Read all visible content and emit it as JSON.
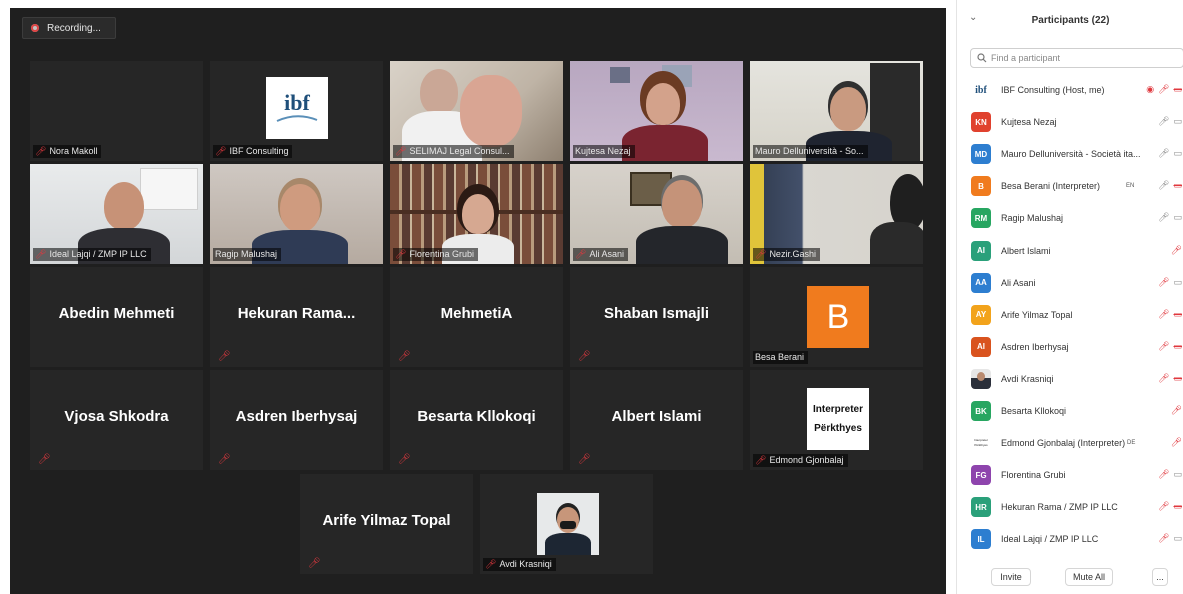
{
  "recording": {
    "label": "Recording..."
  },
  "grid": {
    "row1": [
      {
        "name": "Nora Makoll",
        "muted": true
      },
      {
        "name": "IBF Consulting",
        "muted": true,
        "logo_text": "ibf"
      },
      {
        "name": "SELIMAJ Legal Consul...",
        "muted": true
      },
      {
        "name": "Kujtesa Nezaj",
        "muted": false,
        "active_speaker": true
      },
      {
        "name": "Mauro Delluniversità - So...",
        "muted": false
      }
    ],
    "row2": [
      {
        "name": "Ideal Lajqi / ZMP IP LLC",
        "muted": true
      },
      {
        "name": "Ragip Malushaj",
        "muted": false
      },
      {
        "name": "Florentina Grubi",
        "muted": true
      },
      {
        "name": "Ali Asani",
        "muted": true
      },
      {
        "name": "Nezir.Gashi",
        "muted": true
      }
    ],
    "row3": [
      {
        "name": "Abedin Mehmeti"
      },
      {
        "name": "Hekuran  Rama..."
      },
      {
        "name": "MehmetiA"
      },
      {
        "name": "Shaban Ismajli"
      },
      {
        "name": "Besa Berani",
        "avatar_letter": "B"
      }
    ],
    "row4": [
      {
        "name": "Vjosa Shkodra"
      },
      {
        "name": "Asdren Iberhysaj"
      },
      {
        "name": "Besarta Kllokoqi"
      },
      {
        "name": "Albert Islami"
      },
      {
        "name": "Edmond Gjonbalaj",
        "card_line1": "Interpreter",
        "card_line2": "Përkthyes"
      }
    ],
    "row5": [
      {
        "name": "Arife Yilmaz Topal"
      },
      {
        "name": "Avdi Krasniqi"
      }
    ]
  },
  "panel": {
    "title": "Participants (22)",
    "collapse_icon": "chevron-down-icon",
    "search_placeholder": "Find a participant",
    "participants": [
      {
        "initials": "ibf",
        "name": "IBF Consulting (Host, me)",
        "color": "#ffffff",
        "badge": "",
        "mic": "muted",
        "video": "off",
        "sharing": true
      },
      {
        "initials": "KN",
        "name": "Kujtesa Nezaj",
        "color": "#e0412e",
        "badge": "",
        "mic": "on",
        "video": "on"
      },
      {
        "initials": "MD",
        "name": "Mauro Delluniversità - Società ita...",
        "color": "#2d7ed0",
        "badge": "",
        "mic": "on",
        "video": "on"
      },
      {
        "initials": "B",
        "name": "Besa Berani (Interpreter)",
        "color": "#f07b1e",
        "badge": "EN",
        "mic": "on",
        "video": "off"
      },
      {
        "initials": "RM",
        "name": "Ragip Malushaj",
        "color": "#27a661",
        "badge": "",
        "mic": "on",
        "video": "on"
      },
      {
        "initials": "AI",
        "name": "Albert Islami",
        "color": "#2aa07a",
        "badge": "",
        "mic": "muted",
        "video": "none"
      },
      {
        "initials": "AA",
        "name": "Ali Asani",
        "color": "#2d7ed0",
        "badge": "",
        "mic": "muted",
        "video": "on"
      },
      {
        "initials": "AY",
        "name": "Arife Yilmaz Topal",
        "color": "#f2a31b",
        "badge": "",
        "mic": "muted",
        "video": "off"
      },
      {
        "initials": "AI",
        "name": "Asdren Iberhysaj",
        "color": "#d9531e",
        "badge": "",
        "mic": "muted",
        "video": "off"
      },
      {
        "initials": "",
        "name": "Avdi Krasniqi",
        "color": "#8a8a8a",
        "badge": "",
        "mic": "muted",
        "video": "off",
        "photo": true
      },
      {
        "initials": "BK",
        "name": "Besarta Kllokoqi",
        "color": "#27a661",
        "badge": "",
        "mic": "muted",
        "video": "none"
      },
      {
        "initials": "Interpreter Përkthyes",
        "name": "Edmond Gjonbalaj (Interpreter)",
        "color": "#ffffff",
        "badge": "DE",
        "mic": "muted",
        "video": "none"
      },
      {
        "initials": "FG",
        "name": "Florentina Grubi",
        "color": "#8e44ad",
        "badge": "",
        "mic": "muted",
        "video": "on"
      },
      {
        "initials": "HR",
        "name": "Hekuran Rama / ZMP IP LLC",
        "color": "#2aa07a",
        "badge": "",
        "mic": "muted",
        "video": "off"
      },
      {
        "initials": "IL",
        "name": "Ideal Lajqi / ZMP IP LLC",
        "color": "#2d7ed0",
        "badge": "",
        "mic": "muted",
        "video": "on"
      }
    ],
    "invite_label": "Invite",
    "mute_all_label": "Mute All",
    "more_label": "..."
  }
}
